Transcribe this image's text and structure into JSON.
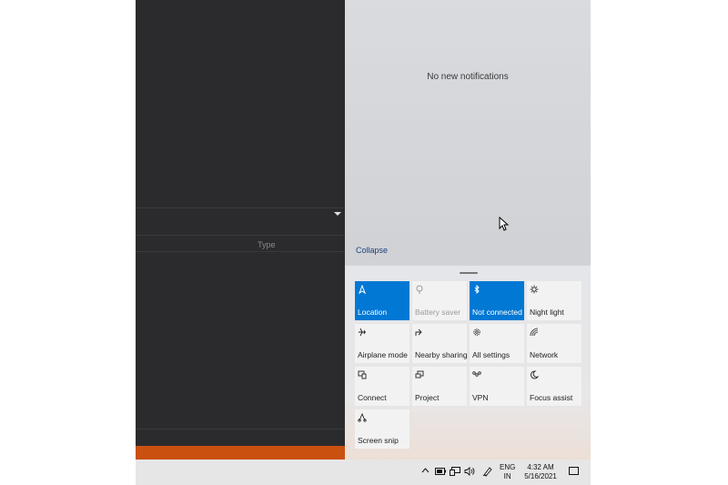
{
  "background_app": {
    "column_header": "Type",
    "accent_color": "#ca5010"
  },
  "action_center": {
    "empty_message": "No new notifications",
    "collapse_label": "Collapse",
    "accent_color": "#0078d4",
    "quick_actions": [
      {
        "label": "Location",
        "icon": "location-icon",
        "state": "on"
      },
      {
        "label": "Battery saver",
        "icon": "battery-saver-icon",
        "state": "disabled"
      },
      {
        "label": "Not connected",
        "icon": "bluetooth-icon",
        "state": "on"
      },
      {
        "label": "Night light",
        "icon": "night-light-icon",
        "state": "off"
      },
      {
        "label": "Airplane mode",
        "icon": "airplane-icon",
        "state": "off"
      },
      {
        "label": "Nearby sharing",
        "icon": "nearby-sharing-icon",
        "state": "off"
      },
      {
        "label": "All settings",
        "icon": "gear-icon",
        "state": "off"
      },
      {
        "label": "Network",
        "icon": "network-icon",
        "state": "off"
      },
      {
        "label": "Connect",
        "icon": "connect-icon",
        "state": "off"
      },
      {
        "label": "Project",
        "icon": "project-icon",
        "state": "off"
      },
      {
        "label": "VPN",
        "icon": "vpn-icon",
        "state": "off"
      },
      {
        "label": "Focus assist",
        "icon": "moon-icon",
        "state": "off"
      },
      {
        "label": "Screen snip",
        "icon": "screen-snip-icon",
        "state": "off"
      }
    ]
  },
  "taskbar": {
    "language_line1": "ENG",
    "language_line2": "IN",
    "time": "4:32 AM",
    "date": "5/16/2021"
  }
}
